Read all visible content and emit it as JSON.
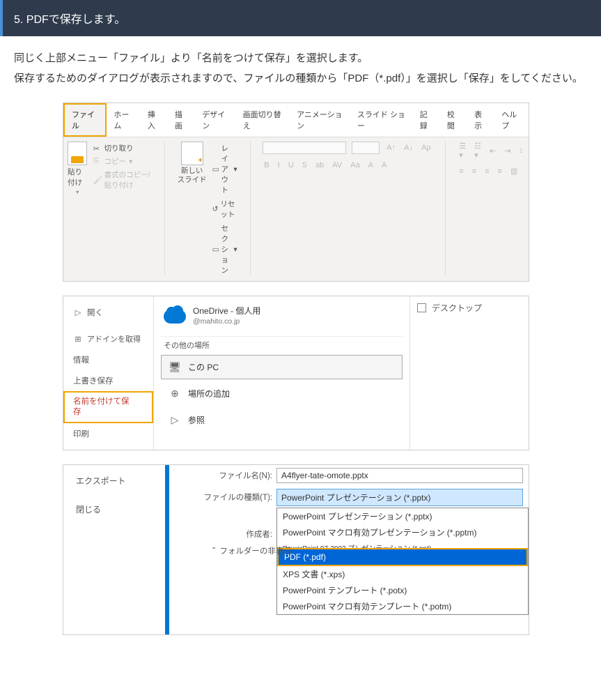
{
  "step": {
    "number": "5.",
    "title": "PDFで保存します。"
  },
  "instruction": {
    "line1": "同じく上部メニュー「ファイル」より「名前をつけて保存」を選択します。",
    "line2": "保存するためのダイアログが表示されますので、ファイルの種類から「PDF（*.pdf）」を選択し「保存」をしてください。"
  },
  "ribbon": {
    "tabs": [
      "ファイル",
      "ホーム",
      "挿入",
      "描画",
      "デザイン",
      "画面切り替え",
      "アニメーション",
      "スライド ショー",
      "記録",
      "校閲",
      "表示",
      "ヘルプ"
    ],
    "paste_label": "貼り付け",
    "cut_label": "切り取り",
    "copy_label": "コピー",
    "formatpainter_label": "書式のコピー/貼り付け",
    "newslide_label": "新しい\nスライド",
    "layout_label": "レイアウト",
    "reset_label": "リセット",
    "section_label": "セクション",
    "font_btns": [
      "B",
      "I",
      "U",
      "S",
      "ab",
      "AV",
      "Aa",
      "A",
      "A"
    ],
    "align_btns": [
      "≡",
      "≡",
      "≡",
      "≡",
      "≡",
      "↕",
      "↕"
    ]
  },
  "saveas": {
    "nav": {
      "open": "開く",
      "addin": "アドインを取得",
      "info": "情報",
      "save": "上書き保存",
      "saveas": "名前を付けて保\n存",
      "print": "印刷"
    },
    "onedrive_title": "OneDrive - 個人用",
    "onedrive_sub": "@mahito.co.jp",
    "other_places": "その他の場所",
    "thispc": "この PC",
    "addplace": "場所の追加",
    "browse": "参照",
    "desktop": "デスクトップ"
  },
  "dialog": {
    "export": "エクスポート",
    "close": "閉じる",
    "filename_label": "ファイル名(N):",
    "filename_value": "A4flyer-tate-omote.pptx",
    "filetype_label": "ファイルの種類(T):",
    "filetype_value": "PowerPoint プレゼンテーション (*.pptx)",
    "author_label": "作成者:",
    "hide_folders": "フォルダーの非表示",
    "options": [
      "PowerPoint プレゼンテーション (*.pptx)",
      "PowerPoint マクロ有効プレゼンテーション (*.pptm)",
      "PowerPoint 97-2003 プレゼンテーション (*.ppt)",
      "PDF (*.pdf)",
      "XPS 文書 (*.xps)",
      "PowerPoint テンプレート (*.potx)",
      "PowerPoint マクロ有効テンプレート (*.potm)"
    ]
  }
}
